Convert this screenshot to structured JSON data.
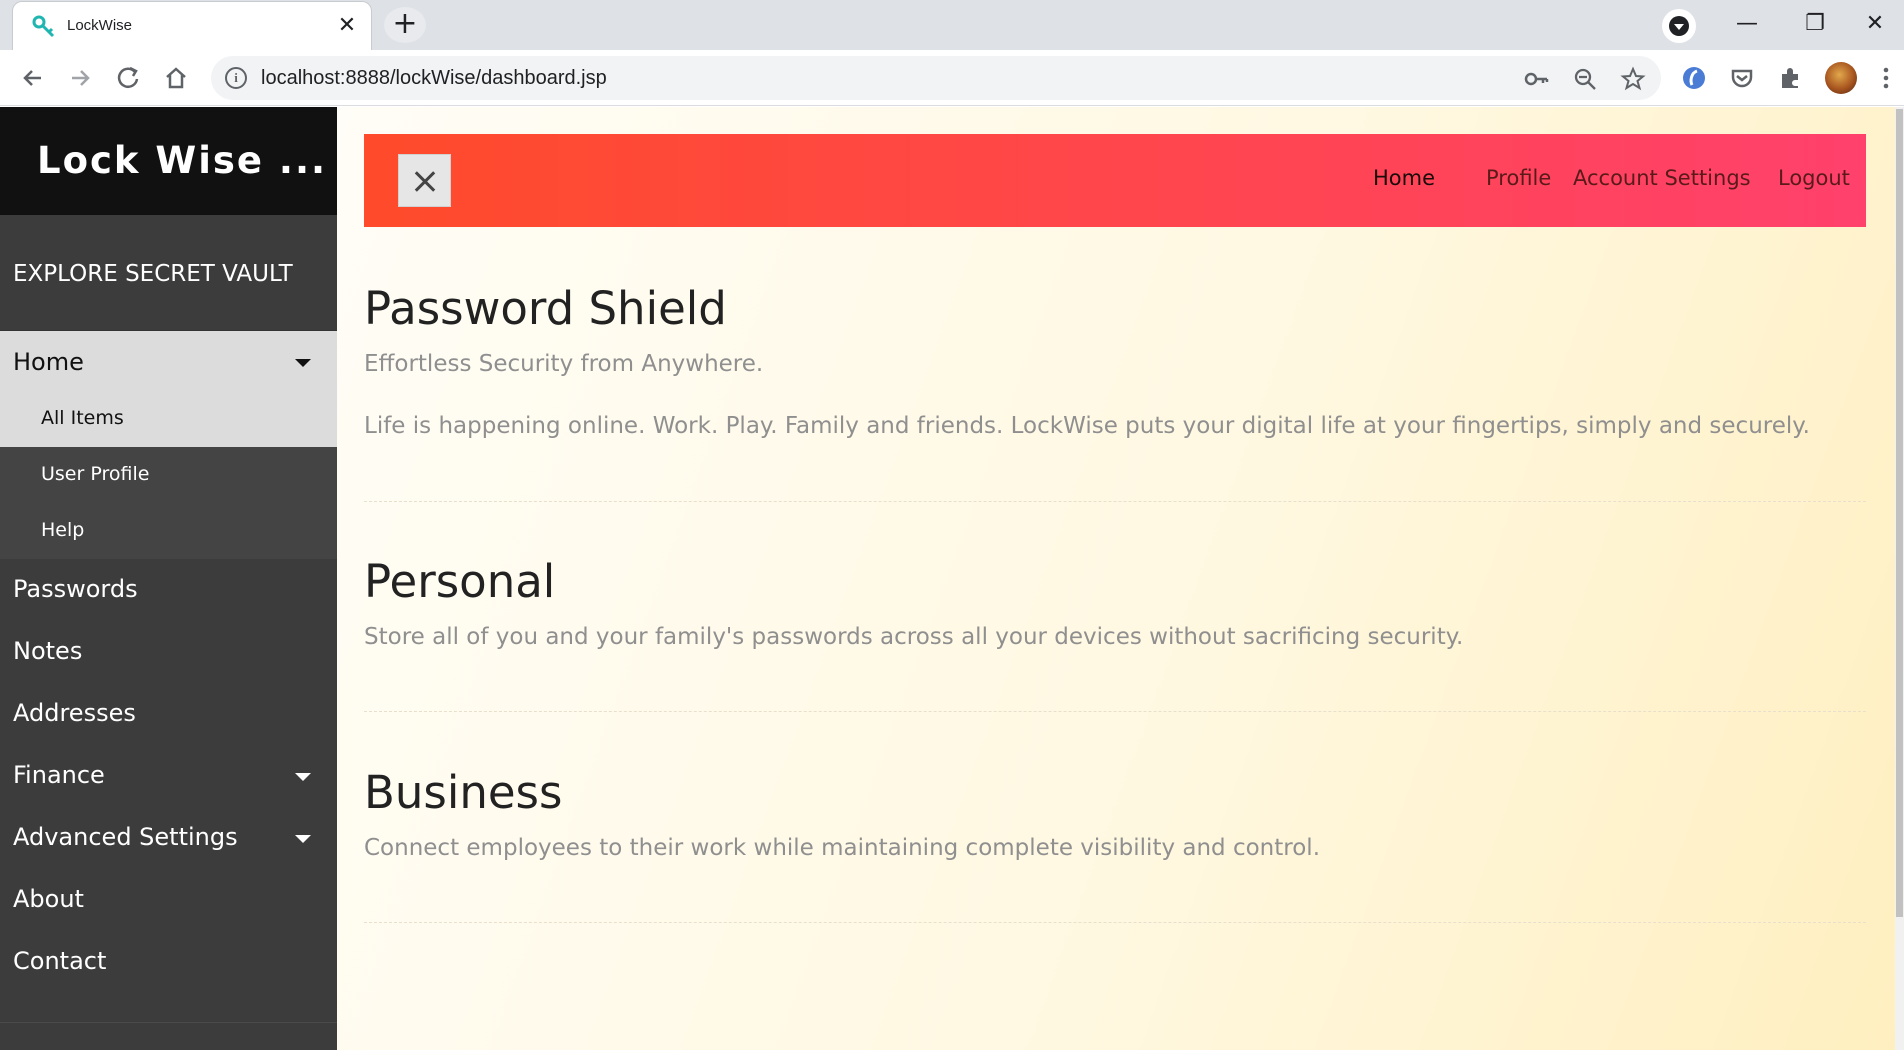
{
  "browser": {
    "tab_title": "LockWise",
    "tab_close": "✕",
    "new_tab": "+",
    "url": "localhost:8888/lockWise/dashboard.jsp",
    "window_minimize": "—",
    "window_restore": "❐",
    "window_close": "✕",
    "icons": [
      "back-icon",
      "forward-icon",
      "reload-icon",
      "home-icon",
      "info-icon",
      "key-icon",
      "zoom-out-icon",
      "star-icon",
      "extension-icon",
      "pocket-icon",
      "puzzle-icon",
      "menu-icon"
    ]
  },
  "sidebar": {
    "brand": "Lock Wise ...",
    "vault_heading": "EXPLORE SECRET VAULT",
    "home": "Home",
    "home_submenu": [
      "All Items",
      "User Profile",
      "Help"
    ],
    "items": [
      "Passwords",
      "Notes",
      "Addresses",
      "Finance",
      "Advanced Settings",
      "About",
      "Contact"
    ]
  },
  "navbar": {
    "links": [
      "Home",
      "Profile",
      "Account Settings",
      "Logout"
    ],
    "active": "Home"
  },
  "sections": [
    {
      "title": "Password Shield",
      "subtitle": "Effortless Security from Anywhere.",
      "text": "Life is happening online. Work. Play. Family and friends. LockWise puts your digital life at your fingertips, simply and securely."
    },
    {
      "title": "Personal",
      "subtitle": "Store all of you and your family's passwords across all your devices without sacrificing security."
    },
    {
      "title": "Business",
      "subtitle": "Connect employees to their work while maintaining complete visibility and control."
    }
  ],
  "colors": {
    "navbar_gradient_start": "#ff4b2b",
    "navbar_gradient_end": "#ff416c",
    "sidebar_bg": "#3c3c3c",
    "brand_bg": "#111111",
    "content_bg": "#fff8e1"
  }
}
